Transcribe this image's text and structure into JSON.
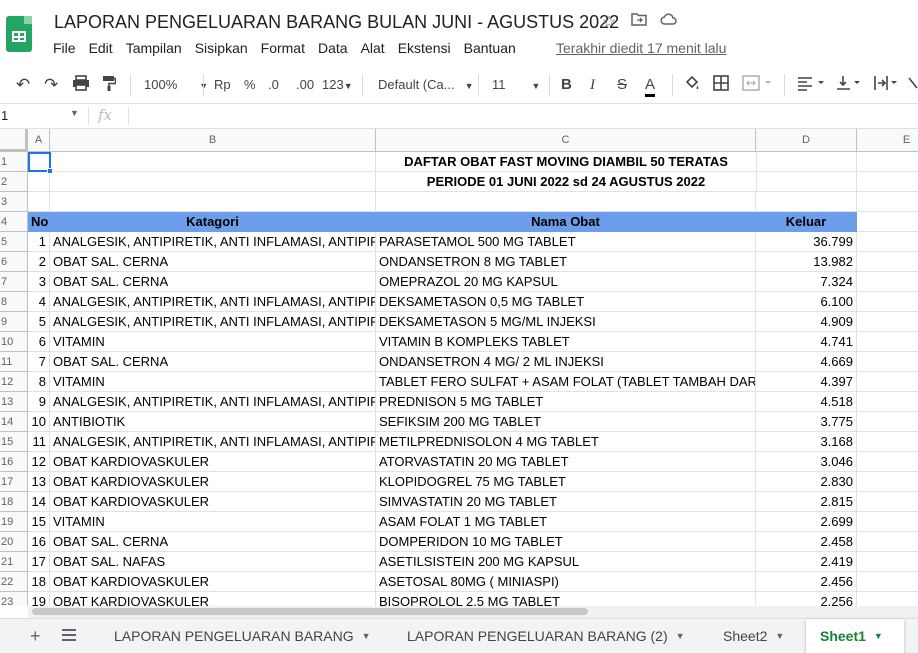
{
  "title": "LAPORAN PENGELUARAN BARANG BULAN JUNI - AGUSTUS 2022",
  "menu": [
    "File",
    "Edit",
    "Tampilan",
    "Sisipkan",
    "Format",
    "Data",
    "Alat",
    "Ekstensi",
    "Bantuan"
  ],
  "last_edit": "Terakhir diedit 17 menit lalu",
  "toolbar": {
    "zoom": "100%",
    "currency": "Rp",
    "percent": "%",
    "dec_less": ".0",
    "dec_more": ".00",
    "num_format": "123",
    "font": "Default (Ca...",
    "font_size": "11",
    "bold": "B",
    "italic": "I",
    "strike": "S",
    "text_color": "A"
  },
  "formula_bar": {
    "cell_ref": "1",
    "fx": "fx",
    "content": ""
  },
  "columns": [
    {
      "label": "A"
    },
    {
      "label": "B"
    },
    {
      "label": "C"
    },
    {
      "label": "D"
    },
    {
      "label": "E"
    }
  ],
  "sheet": {
    "title1": "DAFTAR OBAT FAST MOVING DIAMBIL 50 TERATAS",
    "title2": "PERIODE 01 JUNI 2022 sd 24 AGUSTUS 2022",
    "headers": {
      "no": "No",
      "kategori": "Katagori",
      "nama": "Nama Obat",
      "keluar": "Keluar"
    },
    "rows": [
      {
        "no": "1",
        "kategori": "ANALGESIK, ANTIPIRETIK, ANTI INFLAMASI, ANTIPIRAI",
        "nama": "PARASETAMOL  500 MG TABLET",
        "keluar": "36.799"
      },
      {
        "no": "2",
        "kategori": "OBAT SAL. CERNA",
        "nama": "ONDANSETRON 8 MG TABLET",
        "keluar": "13.982"
      },
      {
        "no": "3",
        "kategori": "OBAT SAL. CERNA",
        "nama": "OMEPRAZOL  20 MG KAPSUL",
        "keluar": "7.324"
      },
      {
        "no": "4",
        "kategori": "ANALGESIK, ANTIPIRETIK, ANTI INFLAMASI, ANTIPIRAI",
        "nama": "DEKSAMETASON 0,5 MG TABLET",
        "keluar": "6.100"
      },
      {
        "no": "5",
        "kategori": "ANALGESIK, ANTIPIRETIK, ANTI INFLAMASI, ANTIPIRAI",
        "nama": "DEKSAMETASON  5 MG/ML INJEKSI",
        "keluar": "4.909"
      },
      {
        "no": "6",
        "kategori": "VITAMIN",
        "nama": "VITAMIN B KOMPLEKS TABLET",
        "keluar": "4.741"
      },
      {
        "no": "7",
        "kategori": "OBAT SAL. CERNA",
        "nama": "ONDANSETRON 4 MG/ 2 ML INJEKSI",
        "keluar": "4.669"
      },
      {
        "no": "8",
        "kategori": "VITAMIN",
        "nama": "TABLET FERO SULFAT + ASAM FOLAT (TABLET TAMBAH DARAH)",
        "keluar": "4.397"
      },
      {
        "no": "9",
        "kategori": "ANALGESIK, ANTIPIRETIK, ANTI INFLAMASI, ANTIPIRAI",
        "nama": "PREDNISON 5 MG TABLET",
        "keluar": "4.518"
      },
      {
        "no": "10",
        "kategori": "ANTIBIOTIK",
        "nama": "SEFIKSIM 200 MG TABLET",
        "keluar": "3.775"
      },
      {
        "no": "11",
        "kategori": "ANALGESIK, ANTIPIRETIK, ANTI INFLAMASI, ANTIPIRAI",
        "nama": "METILPREDNISOLON 4 MG TABLET",
        "keluar": "3.168"
      },
      {
        "no": "12",
        "kategori": "OBAT KARDIOVASKULER",
        "nama": "ATORVASTATIN 20 MG TABLET",
        "keluar": "3.046"
      },
      {
        "no": "13",
        "kategori": "OBAT KARDIOVASKULER",
        "nama": "KLOPIDOGREL 75 MG TABLET",
        "keluar": "2.830"
      },
      {
        "no": "14",
        "kategori": "OBAT KARDIOVASKULER",
        "nama": "SIMVASTATIN 20 MG TABLET",
        "keluar": "2.815"
      },
      {
        "no": "15",
        "kategori": "VITAMIN",
        "nama": "ASAM FOLAT 1 MG TABLET",
        "keluar": "2.699"
      },
      {
        "no": "16",
        "kategori": "OBAT SAL. CERNA",
        "nama": "DOMPERIDON 10 MG TABLET",
        "keluar": "2.458"
      },
      {
        "no": "17",
        "kategori": "OBAT SAL. NAFAS",
        "nama": "ASETILSISTEIN 200 MG KAPSUL",
        "keluar": "2.419"
      },
      {
        "no": "18",
        "kategori": "OBAT KARDIOVASKULER",
        "nama": "ASETOSAL 80MG  ( MINIASPI)",
        "keluar": "2.456"
      },
      {
        "no": "19",
        "kategori": "OBAT KARDIOVASKULER",
        "nama": " BISOPROLOL 2,5 MG TABLET",
        "keluar": "2.256"
      }
    ]
  },
  "sheet_tabs": [
    {
      "label": "LAPORAN PENGELUARAN BARANG",
      "active": false
    },
    {
      "label": "LAPORAN PENGELUARAN BARANG (2)",
      "active": false
    },
    {
      "label": "Sheet2",
      "active": false
    },
    {
      "label": "Sheet1",
      "active": true
    }
  ],
  "colors": {
    "header_bg": "#6d9eeb",
    "selection": "#1a73e8",
    "active_tab": "#188038",
    "brand": "#23a566"
  }
}
